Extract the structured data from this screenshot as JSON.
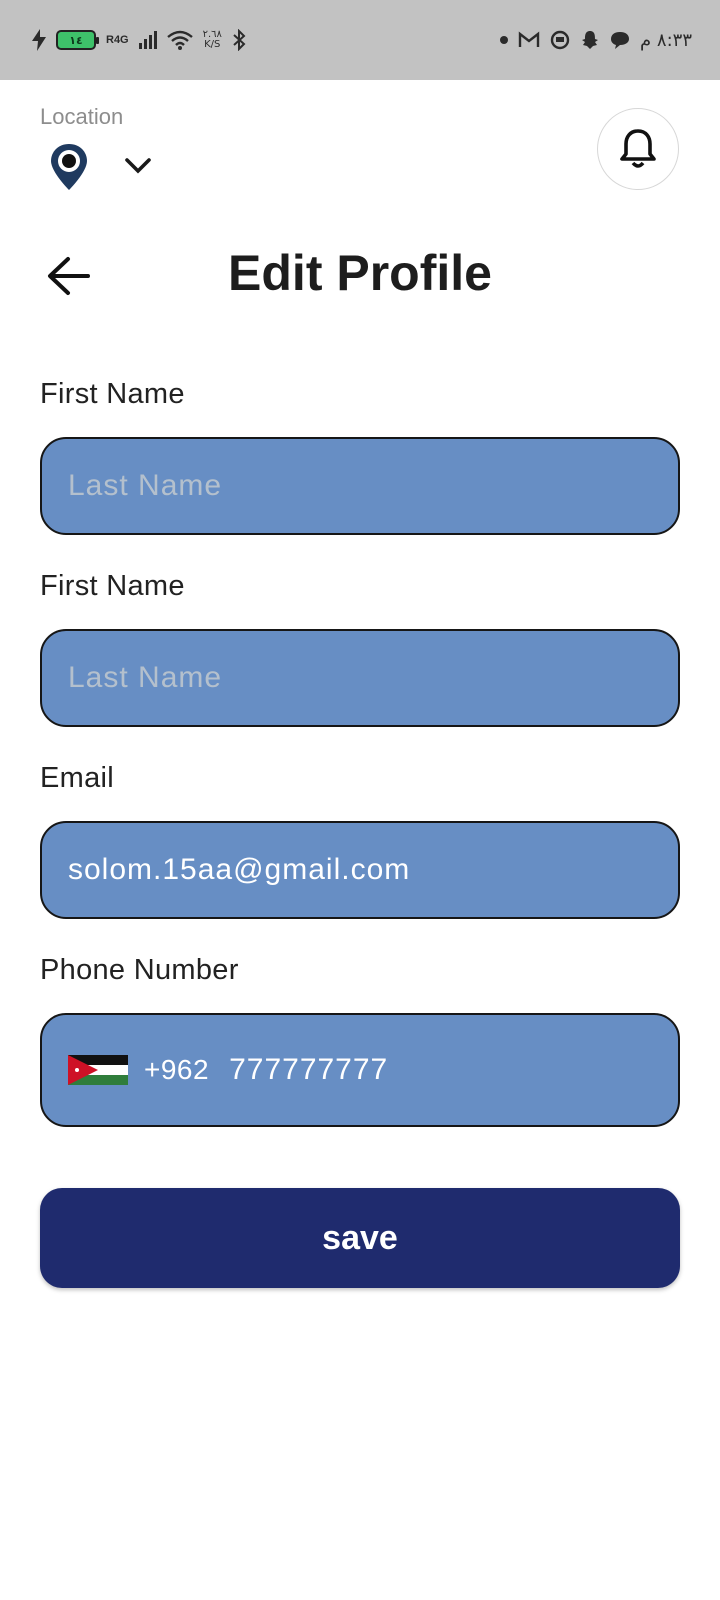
{
  "status_bar": {
    "network_label": "R4G",
    "battery_level": "١٤",
    "speed_value": "٢.٦٨",
    "speed_unit": "K/S",
    "time": "٨:٣٣ م",
    "left_icons": [
      "charging-bolt-icon",
      "battery-icon",
      "signal-icon",
      "wifi-icon",
      "bluetooth-icon"
    ],
    "right_icons": [
      "notification-dot-icon",
      "gmail-icon",
      "app-icon",
      "snapchat-icon",
      "chat-icon"
    ]
  },
  "header": {
    "location_label": "Location",
    "location_icon": "map-pin-icon",
    "dropdown_icon": "chevron-down-icon",
    "notification_icon": "bell-icon"
  },
  "page": {
    "back_icon": "arrow-left-icon",
    "title": "Edit Profile"
  },
  "form": {
    "first_name": {
      "label": "First Name",
      "placeholder": "Last Name",
      "value": ""
    },
    "last_name": {
      "label": "First Name",
      "placeholder": "Last Name",
      "value": ""
    },
    "email": {
      "label": "Email",
      "placeholder": "",
      "value": "solom.15aa@gmail.com"
    },
    "phone": {
      "label": "Phone Number",
      "country_flag": "jordan-flag-icon",
      "country_code": "+962",
      "value": "777777777"
    }
  },
  "save_label": "save",
  "colors": {
    "status_bar_bg": "#c2c2c2",
    "field_bg": "#678ec4",
    "button_bg": "#1f2b6e",
    "pin_color": "#1f3a5f"
  }
}
